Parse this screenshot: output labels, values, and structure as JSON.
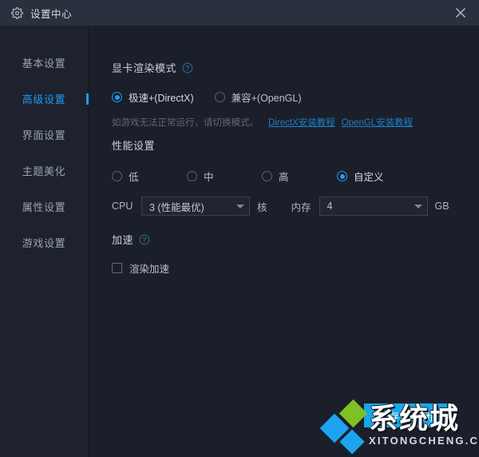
{
  "window": {
    "title": "设置中心",
    "gear_icon": "gear-icon",
    "close_icon": "close-icon"
  },
  "sidebar": {
    "items": [
      {
        "label": "基本设置",
        "active": false
      },
      {
        "label": "高级设置",
        "active": true
      },
      {
        "label": "界面设置",
        "active": false
      },
      {
        "label": "主题美化",
        "active": false
      },
      {
        "label": "属性设置",
        "active": false
      },
      {
        "label": "游戏设置",
        "active": false
      }
    ]
  },
  "render_mode": {
    "title": "显卡渲染模式",
    "help_icon": "help-circle-icon",
    "options": [
      {
        "label": "极速+(DirectX)",
        "selected": true
      },
      {
        "label": "兼容+(OpenGL)",
        "selected": false
      }
    ],
    "hint": "如游戏无法正常运行，请切换模式。",
    "links": [
      {
        "label": "DirectX安装教程"
      },
      {
        "label": "OpenGL安装教程"
      }
    ]
  },
  "performance": {
    "title": "性能设置",
    "options": [
      {
        "label": "低",
        "selected": false
      },
      {
        "label": "中",
        "selected": false
      },
      {
        "label": "高",
        "selected": false
      },
      {
        "label": "自定义",
        "selected": true
      }
    ],
    "cpu": {
      "label": "CPU",
      "value": "3 (性能最优)",
      "unit": "核"
    },
    "memory": {
      "label": "内存",
      "value": "4",
      "unit": "GB"
    }
  },
  "acceleration": {
    "title": "加速",
    "help_icon": "help-circle-icon",
    "checkbox": {
      "label": "渲染加速",
      "checked": false
    }
  },
  "footer": {
    "save_label": "保存并关闭"
  },
  "watermark": {
    "brand": "系统城",
    "url": "XITONGCHENG.COM"
  },
  "colors": {
    "accent": "#1e9cf0",
    "titlebar": "#2b303e",
    "sidebar_bg": "#1e222e",
    "content_bg": "#1b1f2a",
    "link": "#1c7fc4",
    "save_btn": "#18a7e8"
  }
}
